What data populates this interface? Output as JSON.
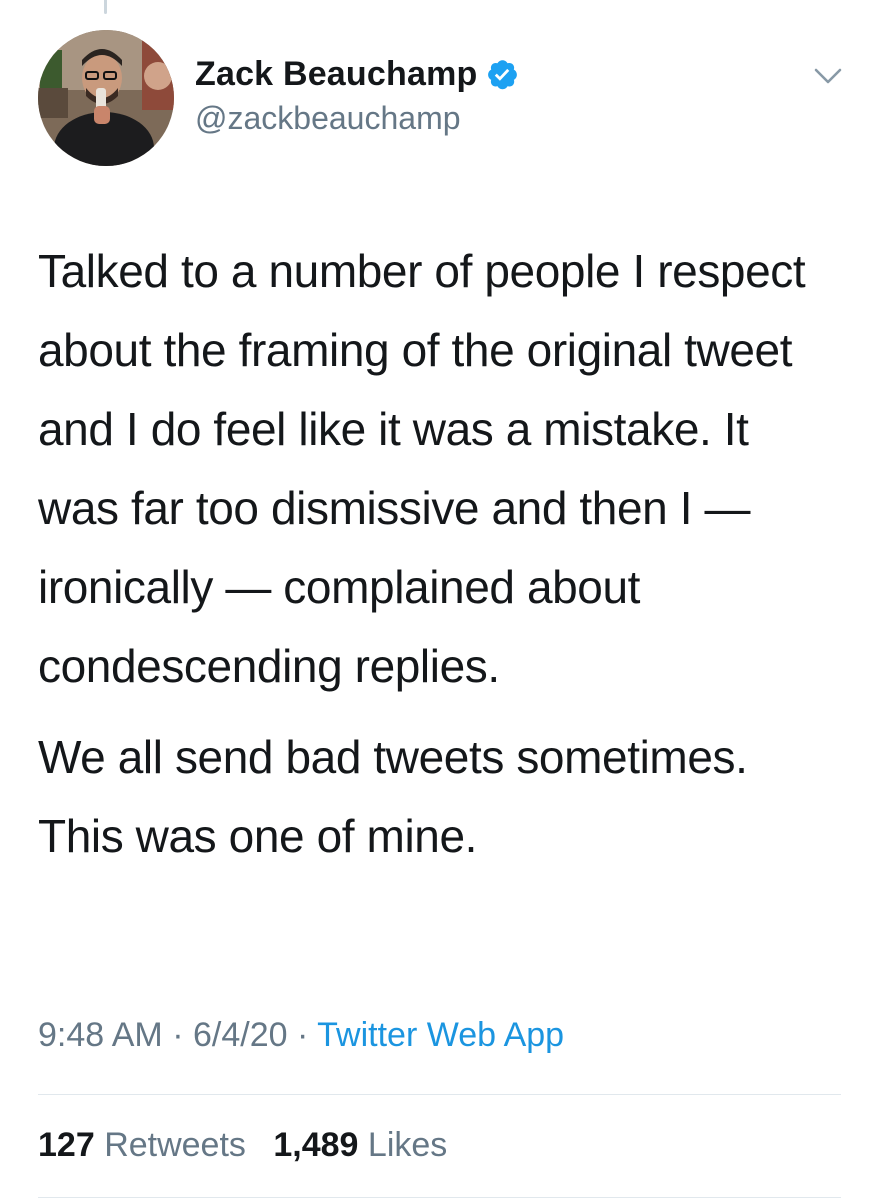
{
  "author": {
    "display_name": "Zack Beauchamp",
    "handle": "@zackbeauchamp",
    "verified": true,
    "verified_icon": "verified-badge-icon",
    "avatar_icon": "profile-photo"
  },
  "tweet": {
    "paragraphs": [
      "Talked to a number of people I respect about the framing of the original tweet and I do feel like it was a mistake. It was far too dismissive and then I — ironically — complained about condescending replies.",
      "We all send bad tweets sometimes. This was one of mine."
    ],
    "time": "9:48 AM",
    "separator": "·",
    "date": "6/4/20",
    "source": "Twitter Web App"
  },
  "stats": {
    "retweets_count": "127",
    "retweets_label": "Retweets",
    "likes_count": "1,489",
    "likes_label": "Likes"
  },
  "colors": {
    "accent": "#1b95e0",
    "secondary_text": "#657786",
    "primary_text": "#14171a",
    "divider": "#e1e8ed"
  },
  "menu_icon": "chevron-down-icon"
}
